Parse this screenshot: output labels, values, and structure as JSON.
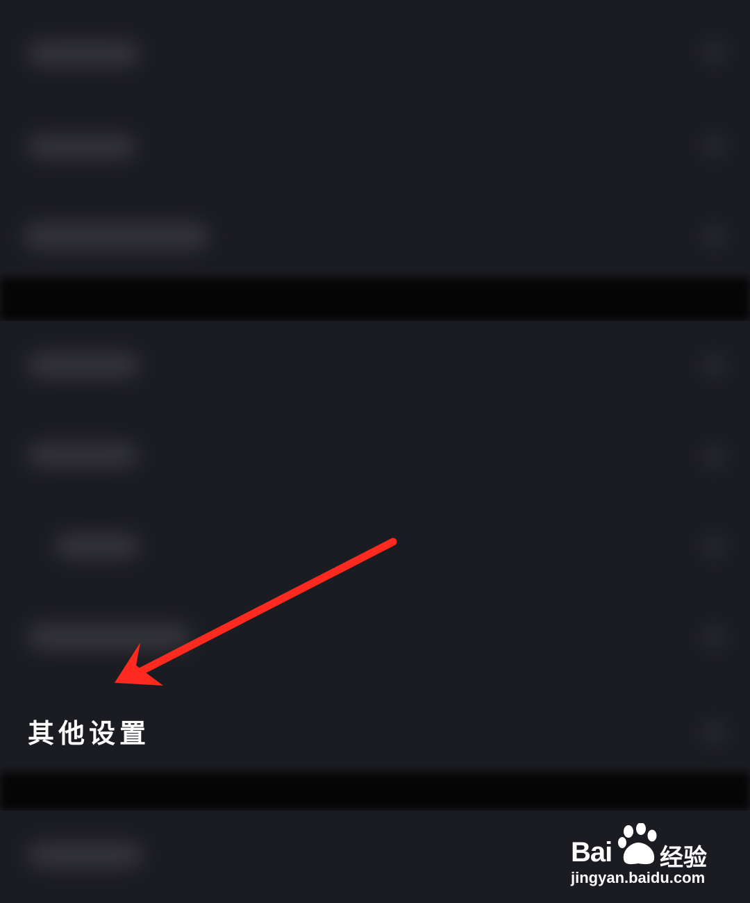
{
  "settings": {
    "other_settings_label": "其他设置"
  },
  "watermark": {
    "brand_prefix": "Bai",
    "brand_suffix": "du",
    "product": "经验",
    "url": "jingyan.baidu.com"
  },
  "colors": {
    "background": "#1b1c21",
    "divider": "#050506",
    "arrow": "#ff2a1f",
    "text": "#ffffff"
  },
  "icons": {
    "annotation": "red-arrow-icon",
    "logo": "baidu-paw-icon"
  }
}
